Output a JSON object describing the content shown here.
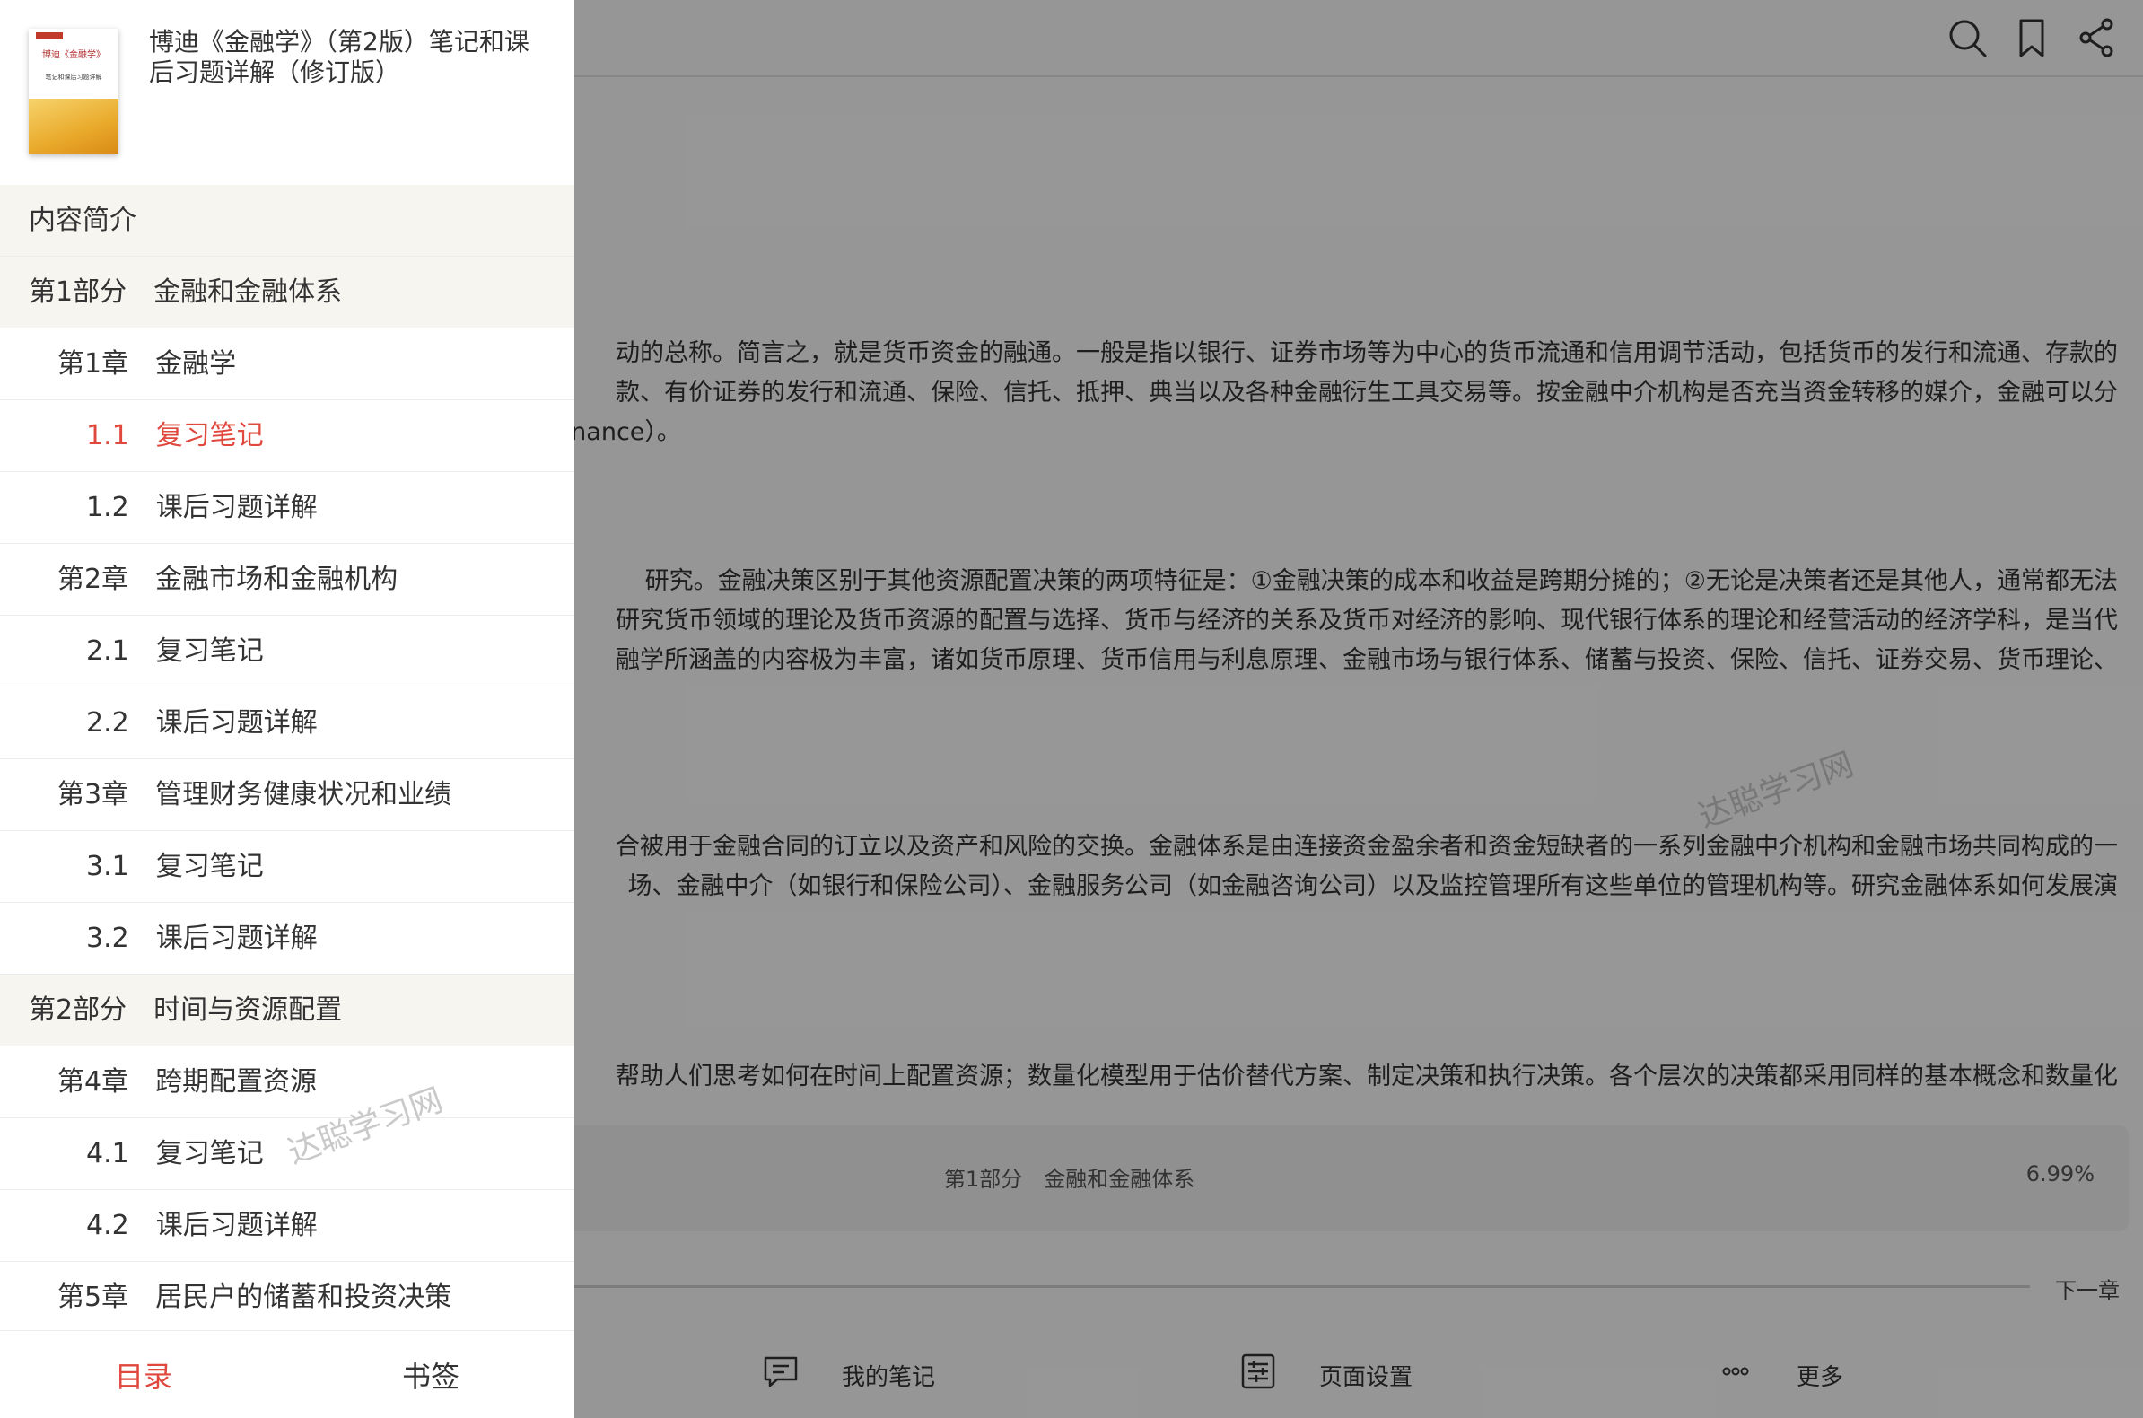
{
  "book": {
    "title": "博迪《金融学》（第2版）笔记和课后习题详解（修订版）",
    "cover": {
      "title": "博迪《金融学》",
      "subtitle": "笔记和课后习题详解"
    }
  },
  "toc": [
    {
      "label": "内容简介",
      "level": 0,
      "kind": "part"
    },
    {
      "label": "第1部分　金融和金融体系",
      "level": 0,
      "kind": "part"
    },
    {
      "label": "第1章　金融学",
      "level": 1,
      "kind": "chapter"
    },
    {
      "label": "1.1　复习笔记",
      "level": 2,
      "kind": "section",
      "active": true
    },
    {
      "label": "1.2　课后习题详解",
      "level": 2,
      "kind": "section"
    },
    {
      "label": "第2章　金融市场和金融机构",
      "level": 1,
      "kind": "chapter"
    },
    {
      "label": "2.1　复习笔记",
      "level": 2,
      "kind": "section"
    },
    {
      "label": "2.2　课后习题详解",
      "level": 2,
      "kind": "section"
    },
    {
      "label": "第3章　管理财务健康状况和业绩",
      "level": 1,
      "kind": "chapter"
    },
    {
      "label": "3.1　复习笔记",
      "level": 2,
      "kind": "section"
    },
    {
      "label": "3.2　课后习题详解",
      "level": 2,
      "kind": "section"
    },
    {
      "label": "第2部分　时间与资源配置",
      "level": 0,
      "kind": "part"
    },
    {
      "label": "第4章　跨期配置资源",
      "level": 1,
      "kind": "chapter"
    },
    {
      "label": "4.1　复习笔记",
      "level": 2,
      "kind": "section"
    },
    {
      "label": "4.2　课后习题详解",
      "level": 2,
      "kind": "section"
    },
    {
      "label": "第5章　居民户的储蓄和投资决策",
      "level": 1,
      "kind": "chapter"
    }
  ],
  "drawer_tabs": {
    "contents": "目录",
    "bookmarks": "书签"
  },
  "watermark": "达聪学习网",
  "reader": {
    "icons": [
      "search-icon",
      "bookmark-icon",
      "share-icon"
    ],
    "paragraphs": [
      [
        "动的总称。简言之，就是货币资金的融通。一般是指以银行、证券市场等为中心的货币流通和信用调节活动，包括货币的发行和流通、存款的",
        "款、有价证券的发行和流通、保险、信托、抵押、典当以及各种金融衍生工具交易等。按金融中介机构是否充当资金转移的媒介，金融可以分",
        "t finance）。"
      ],
      [
        "研究。金融决策区别于其他资源配置决策的两项特征是：①金融决策的成本和收益是跨期分摊的；②无论是决策者还是其他人，通常都无法",
        "研究货币领域的理论及货币资源的配置与选择、货币与经济的关系及货币对经济的影响、现代银行体系的理论和经营活动的经济学科，是当代",
        "融学所涵盖的内容极为丰富，诸如货币原理、货币信用与利息原理、金融市场与银行体系、储蓄与投资、保险、信托、证券交易、货币理论、"
      ],
      [
        "合被用于金融合同的订立以及资产和风险的交换。金融体系是由连接资金盈余者和资金短缺者的一系列金融中介机构和金融市场共同构成的一",
        "场、金融中介（如银行和保险公司）、金融服务公司（如金融咨询公司）以及监控管理所有这些单位的管理机构等。研究金融体系如何发展演"
      ],
      [
        "帮助人们思考如何在时间上配置资源；数量化模型用于估价替代方案、制定决策和执行决策。各个层次的决策都采用同样的基本概念和数量化"
      ]
    ],
    "progress": {
      "chapter": "第1部分　金融和金融体系",
      "percent": "6.99%"
    },
    "next_chapter": "下一章",
    "bottom": {
      "notes": "我的笔记",
      "page_settings": "页面设置",
      "more": "更多"
    }
  },
  "colors": {
    "accent": "#e0483e",
    "part_bg": "#f7f5f0",
    "overlay": "rgba(0,0,0,0.40)"
  }
}
